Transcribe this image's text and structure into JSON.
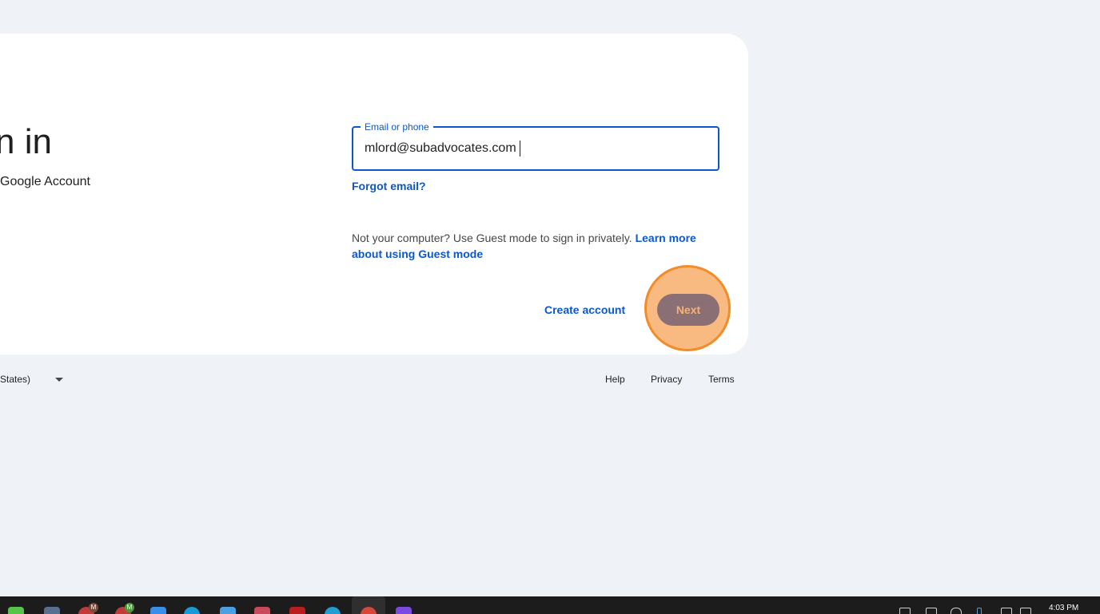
{
  "signin": {
    "title": "n in",
    "subtitle": "Google Account"
  },
  "email_field": {
    "label": "Email or phone",
    "value": "mlord@subadvocates.com"
  },
  "links": {
    "forgot_email": "Forgot email?",
    "create_account": "Create account"
  },
  "guest": {
    "text": "Not your computer? Use Guest mode to sign in privately. ",
    "link": "Learn more about using Guest mode"
  },
  "buttons": {
    "next": "Next"
  },
  "footer": {
    "language": "States)",
    "help": "Help",
    "privacy": "Privacy",
    "terms": "Terms"
  },
  "taskbar": {
    "badge_1": "M",
    "badge_2": "M",
    "clock": "4:03 PM"
  },
  "colors": {
    "accent": "#0b57d0",
    "highlight": "#f28c28",
    "page_bg": "#eff3f8"
  }
}
